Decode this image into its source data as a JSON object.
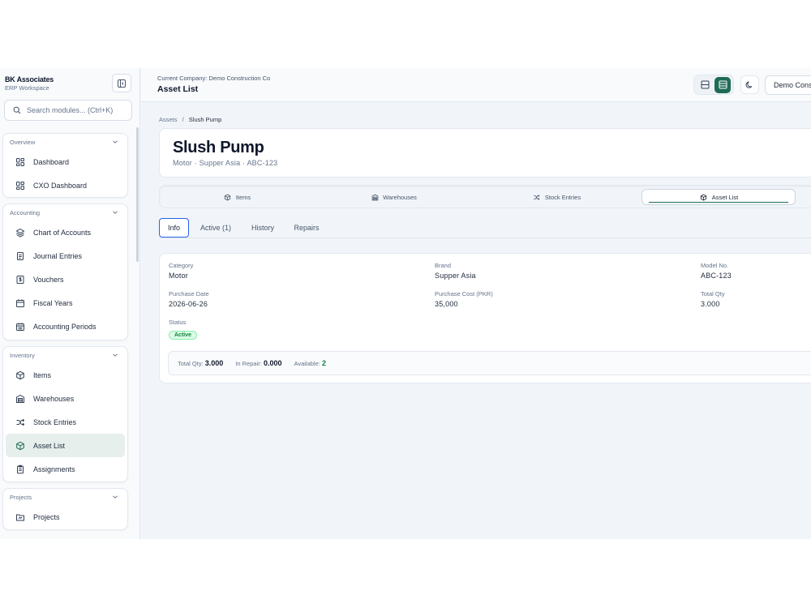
{
  "sidebar": {
    "brand_name": "BK Associates",
    "brand_sub": "ERP Workspace",
    "search_placeholder": "Search modules... (Ctrl+K)",
    "groups": [
      {
        "title": "Overview",
        "items": [
          {
            "label": "Dashboard",
            "icon": "grid-icon"
          },
          {
            "label": "CXO Dashboard",
            "icon": "grid-icon"
          }
        ]
      },
      {
        "title": "Accounting",
        "items": [
          {
            "label": "Chart of Accounts",
            "icon": "layers-icon"
          },
          {
            "label": "Journal Entries",
            "icon": "document-icon"
          },
          {
            "label": "Vouchers",
            "icon": "receipt-icon"
          },
          {
            "label": "Fiscal Years",
            "icon": "calendar-icon"
          },
          {
            "label": "Accounting Periods",
            "icon": "calendar-check-icon"
          }
        ]
      },
      {
        "title": "Inventory",
        "items": [
          {
            "label": "Items",
            "icon": "box-icon"
          },
          {
            "label": "Warehouses",
            "icon": "warehouse-icon"
          },
          {
            "label": "Stock Entries",
            "icon": "shuffle-icon"
          },
          {
            "label": "Asset List",
            "icon": "box-icon",
            "active": true
          },
          {
            "label": "Assignments",
            "icon": "clipboard-icon"
          }
        ]
      },
      {
        "title": "Projects",
        "items": [
          {
            "label": "Projects",
            "icon": "folder-icon"
          }
        ]
      }
    ]
  },
  "header": {
    "company_line": "Current Company: Demo Construction Co",
    "title": "Asset List",
    "company_select": "Demo Construction Co"
  },
  "breadcrumb": {
    "root": "Assets",
    "separator": "/",
    "current": "Slush Pump"
  },
  "asset": {
    "name": "Slush Pump",
    "subtitle": "Motor · Supper Asia · ABC-123"
  },
  "module_tabs": [
    {
      "label": "Items",
      "icon": "box-icon"
    },
    {
      "label": "Warehouses",
      "icon": "warehouse-icon"
    },
    {
      "label": "Stock Entries",
      "icon": "shuffle-icon"
    },
    {
      "label": "Asset List",
      "icon": "box-icon",
      "active": true
    }
  ],
  "detail_tabs": [
    {
      "label": "Info",
      "active": true
    },
    {
      "label": "Active (1)"
    },
    {
      "label": "History"
    },
    {
      "label": "Repairs"
    }
  ],
  "info": {
    "category": {
      "label": "Category",
      "value": "Motor"
    },
    "brand": {
      "label": "Brand",
      "value": "Supper Asia"
    },
    "model": {
      "label": "Model No.",
      "value": "ABC-123"
    },
    "purchase_date": {
      "label": "Purchase Date",
      "value": "2026-06-26"
    },
    "purchase_cost": {
      "label": "Purchase Cost (PKR)",
      "value": "35,000"
    },
    "total_qty": {
      "label": "Total Qty",
      "value": "3.000"
    },
    "status": {
      "label": "Status",
      "value": "Active"
    }
  },
  "summary": {
    "total_label": "Total Qty:",
    "total_value": "3.000",
    "repair_label": "In Repair:",
    "repair_value": "0.000",
    "available_label": "Available:",
    "available_value": "2"
  },
  "colors": {
    "accent": "#1e6b55",
    "active_badge": "#15803d",
    "tab_focus": "#2563eb"
  }
}
